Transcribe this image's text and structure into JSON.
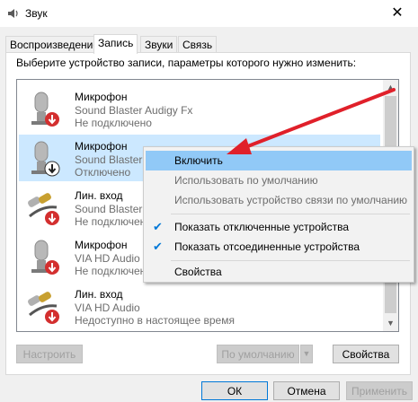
{
  "window": {
    "title": "Звук",
    "close_glyph": "✕"
  },
  "tabs": [
    {
      "label": "Воспроизведение",
      "active": false
    },
    {
      "label": "Запись",
      "active": true
    },
    {
      "label": "Звуки",
      "active": false
    },
    {
      "label": "Связь",
      "active": false
    }
  ],
  "instruction": "Выберите устройство записи, параметры которого нужно изменить:",
  "devices": [
    {
      "name": "Микрофон",
      "line2": "Sound Blaster Audigy Fx",
      "line3": "Не подключено",
      "icon": "microphone-icon",
      "status_icon": "disconnected-badge-icon",
      "selected": false
    },
    {
      "name": "Микрофон",
      "line2": "Sound Blaster",
      "line3": "Отключено",
      "icon": "microphone-icon",
      "status_icon": "disabled-badge-icon",
      "selected": true
    },
    {
      "name": "Лин. вход",
      "line2": "Sound Blaster",
      "line3": "Не подключено",
      "icon": "line-in-icon",
      "status_icon": "disconnected-badge-icon",
      "selected": false
    },
    {
      "name": "Микрофон",
      "line2": "VIA HD Audio",
      "line3": "Не подключено",
      "icon": "microphone-icon",
      "status_icon": "disconnected-badge-icon",
      "selected": false
    },
    {
      "name": "Лин. вход",
      "line2": "VIA HD Audio",
      "line3": "Недоступно в настоящее время",
      "icon": "line-in-icon",
      "status_icon": "disconnected-badge-icon",
      "selected": false
    }
  ],
  "context_menu": {
    "items": [
      {
        "label": "Включить",
        "highlighted": true,
        "disabled": false,
        "checked": false
      },
      {
        "label": "Использовать по умолчанию",
        "highlighted": false,
        "disabled": true,
        "checked": false
      },
      {
        "label": "Использовать устройство связи по умолчанию",
        "highlighted": false,
        "disabled": true,
        "checked": false
      },
      {
        "label": "Показать отключенные устройства",
        "highlighted": false,
        "disabled": false,
        "checked": true
      },
      {
        "label": "Показать отсоединенные устройства",
        "highlighted": false,
        "disabled": false,
        "checked": true
      },
      {
        "label": "Свойства",
        "highlighted": false,
        "disabled": false,
        "checked": false
      }
    ]
  },
  "buttons": {
    "configure": "Настроить",
    "default": "По умолчанию",
    "properties": "Свойства",
    "ok": "ОК",
    "cancel": "Отмена",
    "apply": "Применить"
  },
  "colors": {
    "selection": "#cce8ff",
    "menu_highlight": "#91c9f7",
    "annotation_arrow": "#e0202a",
    "status_red": "#d32f2f"
  }
}
